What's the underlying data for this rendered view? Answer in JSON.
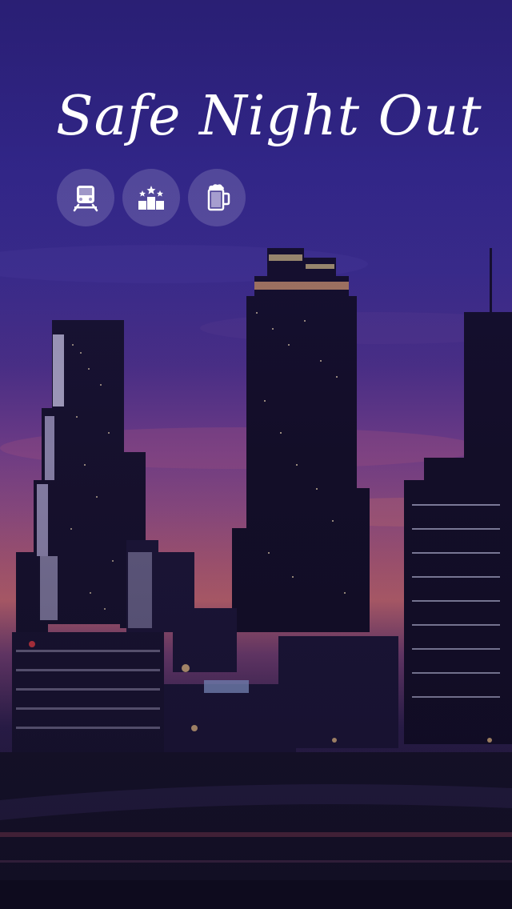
{
  "app": {
    "title": "Safe Night Out"
  },
  "icons": [
    {
      "name": "train-icon",
      "label": "transit"
    },
    {
      "name": "podium-icon",
      "label": "rankings"
    },
    {
      "name": "beer-mug-icon",
      "label": "bars"
    }
  ],
  "colors": {
    "sky_top": "#2a1f73",
    "sky_glow": "#b8606a",
    "icon_bg": "rgba(255,255,255,0.16)",
    "text": "#ffffff"
  }
}
